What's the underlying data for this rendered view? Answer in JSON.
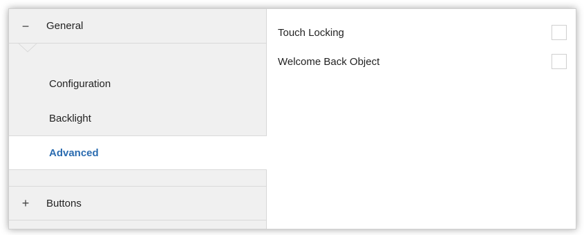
{
  "sidebar": {
    "groups": [
      {
        "toggle": "−",
        "label": "General",
        "expanded": true
      },
      {
        "toggle": "+",
        "label": "Buttons",
        "expanded": false
      }
    ],
    "items": [
      {
        "label": "Configuration",
        "selected": false
      },
      {
        "label": "Backlight",
        "selected": false
      },
      {
        "label": "Advanced",
        "selected": true
      }
    ]
  },
  "content": {
    "parameters": [
      {
        "label": "Touch Locking",
        "checked": false
      },
      {
        "label": "Welcome Back Object",
        "checked": false
      }
    ]
  },
  "colors": {
    "sidebar_bg": "#f0f0f0",
    "selected_text": "#2b6cb0",
    "border": "#d9d9d9"
  }
}
